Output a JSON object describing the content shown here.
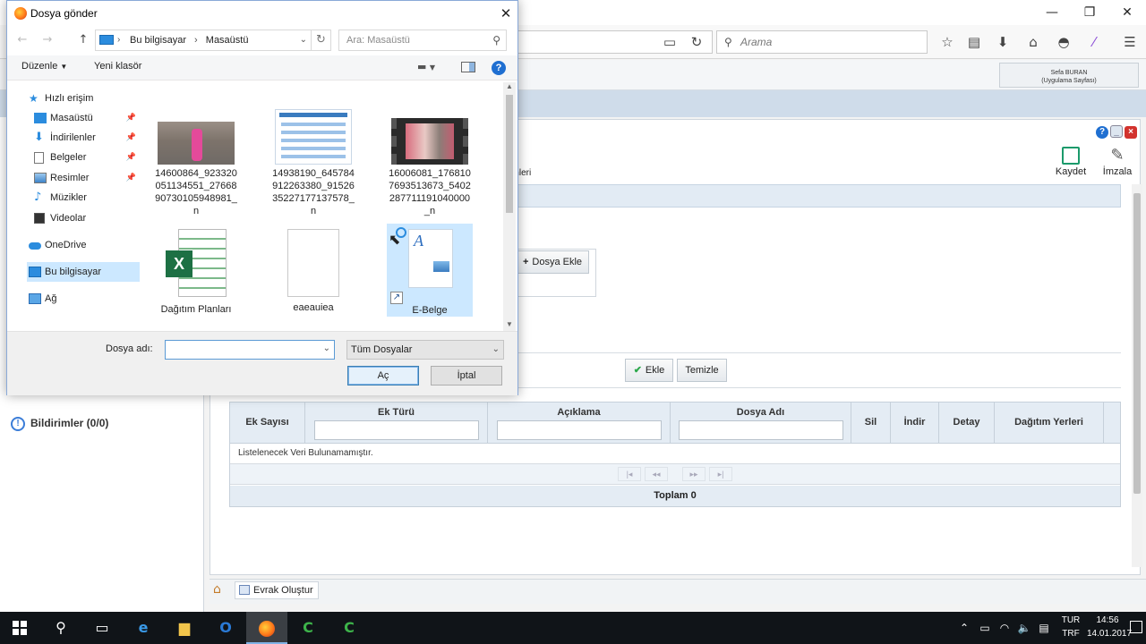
{
  "browser": {
    "search_placeholder": "Arama"
  },
  "app": {
    "user_name": "Sefa BURAN",
    "user_role": "(Uygulama Sayfası)",
    "partial_tab": "emleri",
    "save_label": "Kaydet",
    "sign_label": "İmzala",
    "add_file_label": "Dosya Ekle",
    "add_label": "Ekle",
    "clear_label": "Temizle",
    "notifications_label": "Bildirimler (0/0)",
    "grid": {
      "columns": [
        "Ek Sayısı",
        "Ek Türü",
        "Açıklama",
        "Dosya Adı",
        "Sil",
        "İndir",
        "Detay",
        "Dağıtım Yerleri"
      ],
      "empty_text": "Listelenecek Veri Bulunamamıştır.",
      "total_label": "Toplam 0"
    },
    "bottom_button": "Evrak Oluştur"
  },
  "dialog": {
    "title": "Dosya gönder",
    "path": [
      "Bu bilgisayar",
      "Masaüstü"
    ],
    "search_placeholder": "Ara: Masaüstü",
    "organize_label": "Düzenle",
    "new_folder_label": "Yeni klasör",
    "nav": [
      {
        "label": "Hızlı erişim",
        "icon": "star-icon"
      },
      {
        "label": "Masaüstü",
        "icon": "desktop-icon",
        "pinned": true
      },
      {
        "label": "İndirilenler",
        "icon": "download-icon",
        "pinned": true
      },
      {
        "label": "Belgeler",
        "icon": "documents-icon",
        "pinned": true
      },
      {
        "label": "Resimler",
        "icon": "pictures-icon",
        "pinned": true
      },
      {
        "label": "Müzikler",
        "icon": "music-icon"
      },
      {
        "label": "Videolar",
        "icon": "videos-icon"
      },
      {
        "label": "OneDrive",
        "icon": "cloud-icon"
      },
      {
        "label": "Bu bilgisayar",
        "icon": "computer-icon",
        "selected": true
      },
      {
        "label": "Ağ",
        "icon": "network-icon"
      }
    ],
    "files": [
      {
        "lines": [
          "14600864_923320",
          "051134551_27668",
          "90730105948981_",
          "n"
        ],
        "kind": "photo"
      },
      {
        "lines": [
          "14938190_645784",
          "912263380_91526",
          "35227177137578_",
          "n"
        ],
        "kind": "photo"
      },
      {
        "lines": [
          "16006081_176810",
          "7693513673_5402",
          "287711191040000",
          "_n"
        ],
        "kind": "video"
      },
      {
        "lines": [
          "Dağıtım Planları"
        ],
        "kind": "excel"
      },
      {
        "lines": [
          "eaeauiea"
        ],
        "kind": "blank"
      },
      {
        "lines": [
          "E-Belge"
        ],
        "kind": "shortcut"
      }
    ],
    "filename_label": "Dosya adı:",
    "filename_value": "",
    "filetype_value": "Tüm Dosyalar",
    "open_label": "Aç",
    "cancel_label": "İptal"
  },
  "taskbar": {
    "lang_line1": "TUR",
    "lang_line2": "TRF",
    "time": "14:56",
    "date": "14.01.2017"
  }
}
